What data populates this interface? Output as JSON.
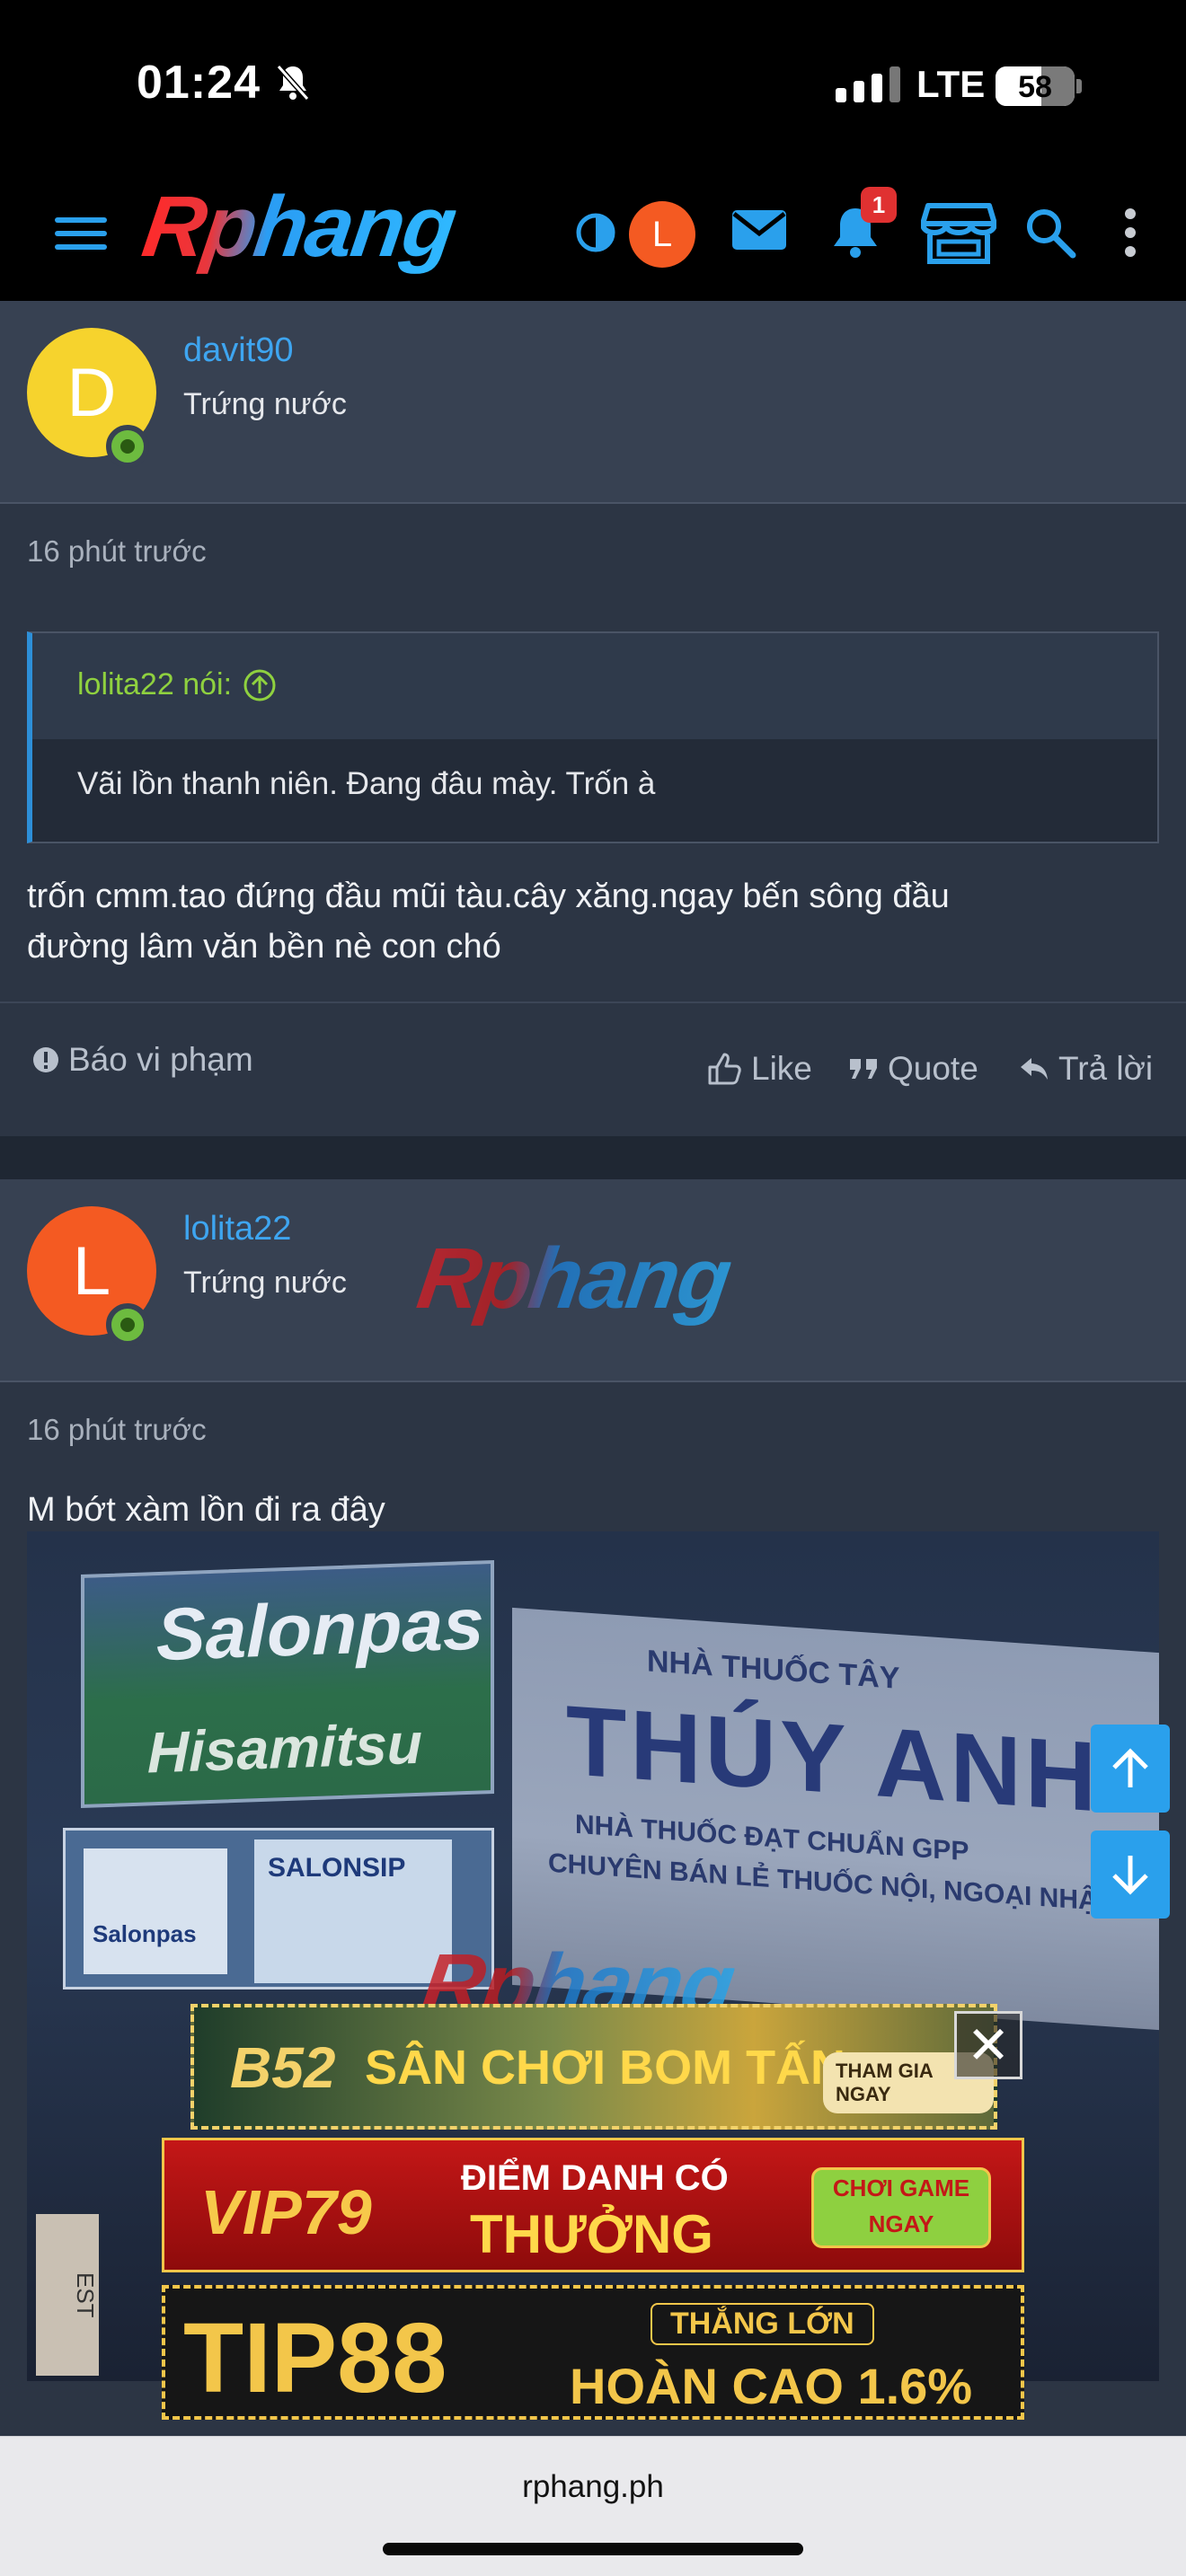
{
  "status_bar": {
    "time": "01:24",
    "network": "LTE",
    "battery_percent": "58",
    "battery_level": 0.58
  },
  "nav": {
    "logo": "Rphang",
    "user_avatar_letter": "L",
    "notification_count": "1",
    "icons": [
      "menu-icon",
      "theme-toggle-icon",
      "mail-icon",
      "bell-icon",
      "store-icon",
      "search-icon",
      "more-icon"
    ]
  },
  "posts": [
    {
      "username": "davit90",
      "user_title": "Trứng nước",
      "avatar_letter": "D",
      "avatar_color": "#f6d32d",
      "time": "16 phút trước",
      "quote": {
        "author": "lolita22 nói:",
        "text": "Vãi lồn thanh niên. Đang đâu mày. Trốn à"
      },
      "body_line1": "trốn cmm.tao đứng đầu mũi tàu.cây xăng.ngay bến sông đầu",
      "body_line2": "đường lâm văn bền nè con chó",
      "actions": {
        "report": "Báo vi phạm",
        "like": "Like",
        "quote": "Quote",
        "reply": "Trả lời"
      }
    },
    {
      "username": "lolita22",
      "user_title": "Trứng nước",
      "avatar_letter": "L",
      "avatar_color": "#f45a22",
      "time": "16 phút trước",
      "body": "M bớt xàm lồn đi ra đây",
      "watermark": "Rphang"
    }
  ],
  "photo": {
    "sign_left_brand": "Salonpas",
    "sign_left_sub": "Hisamitsu",
    "sign_right_top": "NHÀ THUỐC TÂY",
    "sign_right_name": "THÚY ANH",
    "sign_right_line1": "NHÀ THUỐC ĐẠT CHUẨN GPP",
    "sign_right_line2": "CHUYÊN BÁN LẺ THUỐC NỘI, NGOẠI NHẬP",
    "box_label": "SALONSIP",
    "box_small": "Salonpas",
    "est_text": "EST",
    "watermark": "Rphang"
  },
  "ads": {
    "ad1_brand": "B52",
    "ad1_text": "SÂN CHƠI BOM TẤN",
    "ad1_cta": "THAM GIA NGAY",
    "ad2_brand": "VIP79",
    "ad2_line1": "ĐIỂM DANH CÓ",
    "ad2_line2": "THƯỞNG",
    "ad2_cta": "CHƠI GAME NGAY",
    "ad3_brand": "TIP88",
    "ad3_line1": "THẮNG LỚN",
    "ad3_line2": "HOÀN CAO 1.6%",
    "close": "✕"
  },
  "browser": {
    "url": "rphang.ph"
  }
}
